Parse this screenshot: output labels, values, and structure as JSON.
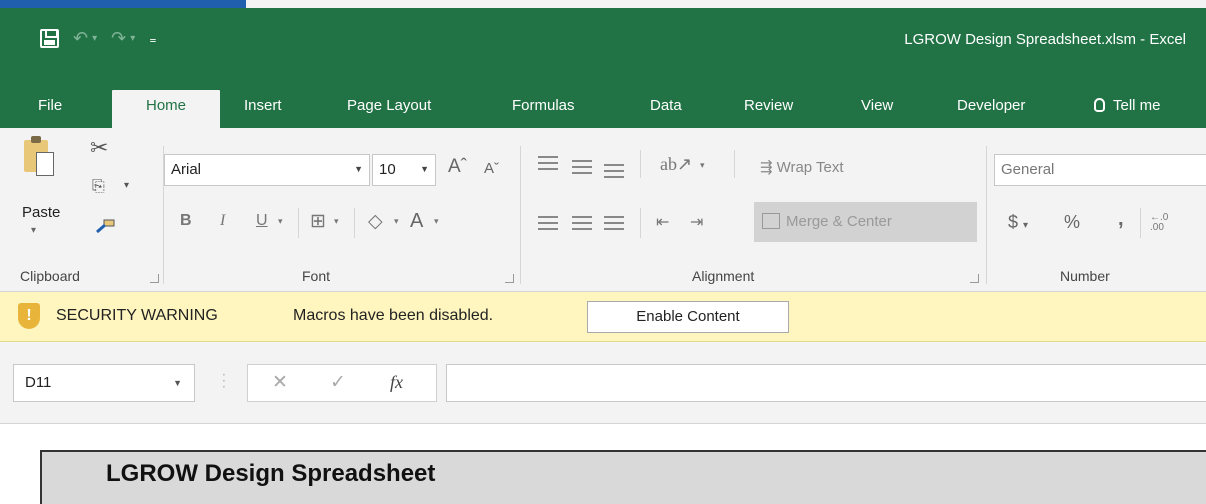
{
  "window": {
    "title": "LGROW Design Spreadsheet.xlsm  -  Excel"
  },
  "tabs": [
    "File",
    "Home",
    "Insert",
    "Page Layout",
    "Formulas",
    "Data",
    "Review",
    "View",
    "Developer",
    "Tell me"
  ],
  "active_tab": "Home",
  "ribbon": {
    "clipboard": {
      "label": "Clipboard",
      "paste_label": "Paste"
    },
    "font": {
      "label": "Font",
      "font_name": "Arial",
      "font_size": "10"
    },
    "alignment": {
      "label": "Alignment",
      "wrap_text": "Wrap Text",
      "merge_center": "Merge & Center"
    },
    "number": {
      "label": "Number",
      "format": "General"
    }
  },
  "security_bar": {
    "heading": "SECURITY WARNING",
    "message": "Macros have been disabled.",
    "button": "Enable Content"
  },
  "formula_bar": {
    "name_box": "D11",
    "formula": ""
  },
  "sheet": {
    "title": "LGROW Design Spreadsheet"
  },
  "colors": {
    "excel_green": "#217346",
    "ribbon_bg": "#f3f3f3",
    "security_bg": "#fff6bf"
  }
}
